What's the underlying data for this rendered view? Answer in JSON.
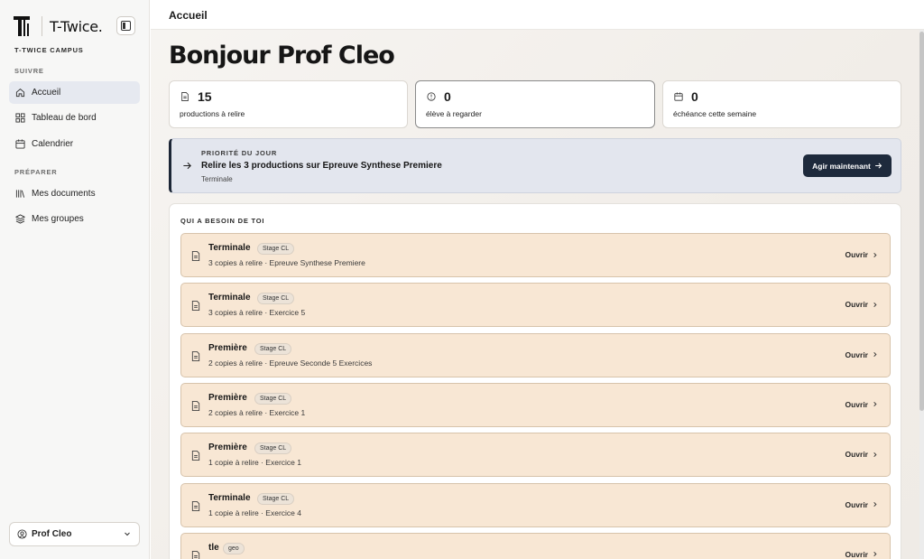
{
  "sidebar": {
    "brand": "T-Twice.",
    "campus": "T-TWICE CAMPUS",
    "sections": [
      {
        "label": "SUIVRE",
        "items": [
          {
            "label": "Accueil",
            "icon": "home-icon",
            "active": true
          },
          {
            "label": "Tableau de bord",
            "icon": "dashboard-icon"
          },
          {
            "label": "Calendrier",
            "icon": "calendar-icon"
          }
        ]
      },
      {
        "label": "PRÉPARER",
        "items": [
          {
            "label": "Mes documents",
            "icon": "library-icon"
          },
          {
            "label": "Mes groupes",
            "icon": "layers-icon"
          }
        ]
      }
    ],
    "user": "Prof Cleo"
  },
  "topbar": {
    "title": "Accueil"
  },
  "main": {
    "greeting": "Bonjour Prof Cleo",
    "stats": [
      {
        "value": "15",
        "label": "productions à relire",
        "icon": "document-icon"
      },
      {
        "value": "0",
        "label": "élève à regarder",
        "icon": "alert-circle-icon"
      },
      {
        "value": "0",
        "label": "échéance cette semaine",
        "icon": "calendar-icon"
      }
    ],
    "priority": {
      "kicker": "PRIORITÉ DU JOUR",
      "title": "Relire les 3 productions sur Epreuve Synthese Premiere",
      "sub": "Terminale",
      "action": "Agir maintenant"
    },
    "needs": {
      "title": "QUI A BESOIN DE TOI",
      "open_label": "Ouvrir",
      "rows": [
        {
          "title": "Terminale",
          "tag": "Stage CL",
          "sub": "3 copies à relire · Epreuve Synthese Premiere"
        },
        {
          "title": "Terminale",
          "tag": "Stage CL",
          "sub": "3 copies à relire · Exercice 5"
        },
        {
          "title": "Première",
          "tag": "Stage CL",
          "sub": "2 copies à relire · Epreuve Seconde 5 Exercices"
        },
        {
          "title": "Première",
          "tag": "Stage CL",
          "sub": "2 copies à relire · Exercice 1"
        },
        {
          "title": "Première",
          "tag": "Stage CL",
          "sub": "1 copie à relire · Exercice 1"
        },
        {
          "title": "Terminale",
          "tag": "Stage CL",
          "sub": "1 copie à relire · Exercice 4"
        },
        {
          "title": "tle",
          "tag": "geo",
          "sub": ""
        }
      ]
    }
  }
}
